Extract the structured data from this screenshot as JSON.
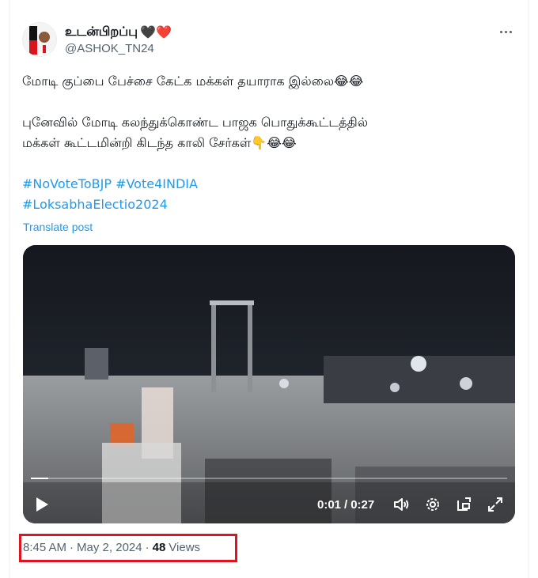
{
  "colors": {
    "accent": "#1d9bf0",
    "text": "#0f1419",
    "muted": "#536471",
    "highlight_box": "#e0141e"
  },
  "tweet": {
    "display_name": "உடன்பிறப்பு",
    "name_emojis": "🖤❤️",
    "handle": "@ASHOK_TN24",
    "more_icon": "more-horizontal-icon",
    "text_line1": "மோடி குப்பை பேச்சை கேட்க மக்கள் தயாராக இல்லை😂😂",
    "text_line2": "புனேவில் மோடி கலந்துக்கொண்ட பாஜக பொதுக்கூட்டத்தில்",
    "text_line3": "மக்கள் கூட்டமின்றி கிடந்த காலி சேர்கள்👇😂😂",
    "hashtags_line1": [
      "#NoVoteToBJP",
      "#Vote4INDIA"
    ],
    "hashtags_line2": [
      "#LoksabhaElectio2024"
    ],
    "translate_label": "Translate post"
  },
  "video": {
    "current_time": "0:01",
    "separator": "/",
    "duration": "0:27",
    "progress_fraction": 0.037,
    "icons": [
      "play-icon",
      "volume-icon",
      "settings-icon",
      "pip-icon",
      "fullscreen-icon"
    ]
  },
  "meta": {
    "time": "8:45 AM",
    "dot1": "·",
    "date": "May 2, 2024",
    "dot2": "·",
    "views_count": "48",
    "views_label": "Views"
  }
}
